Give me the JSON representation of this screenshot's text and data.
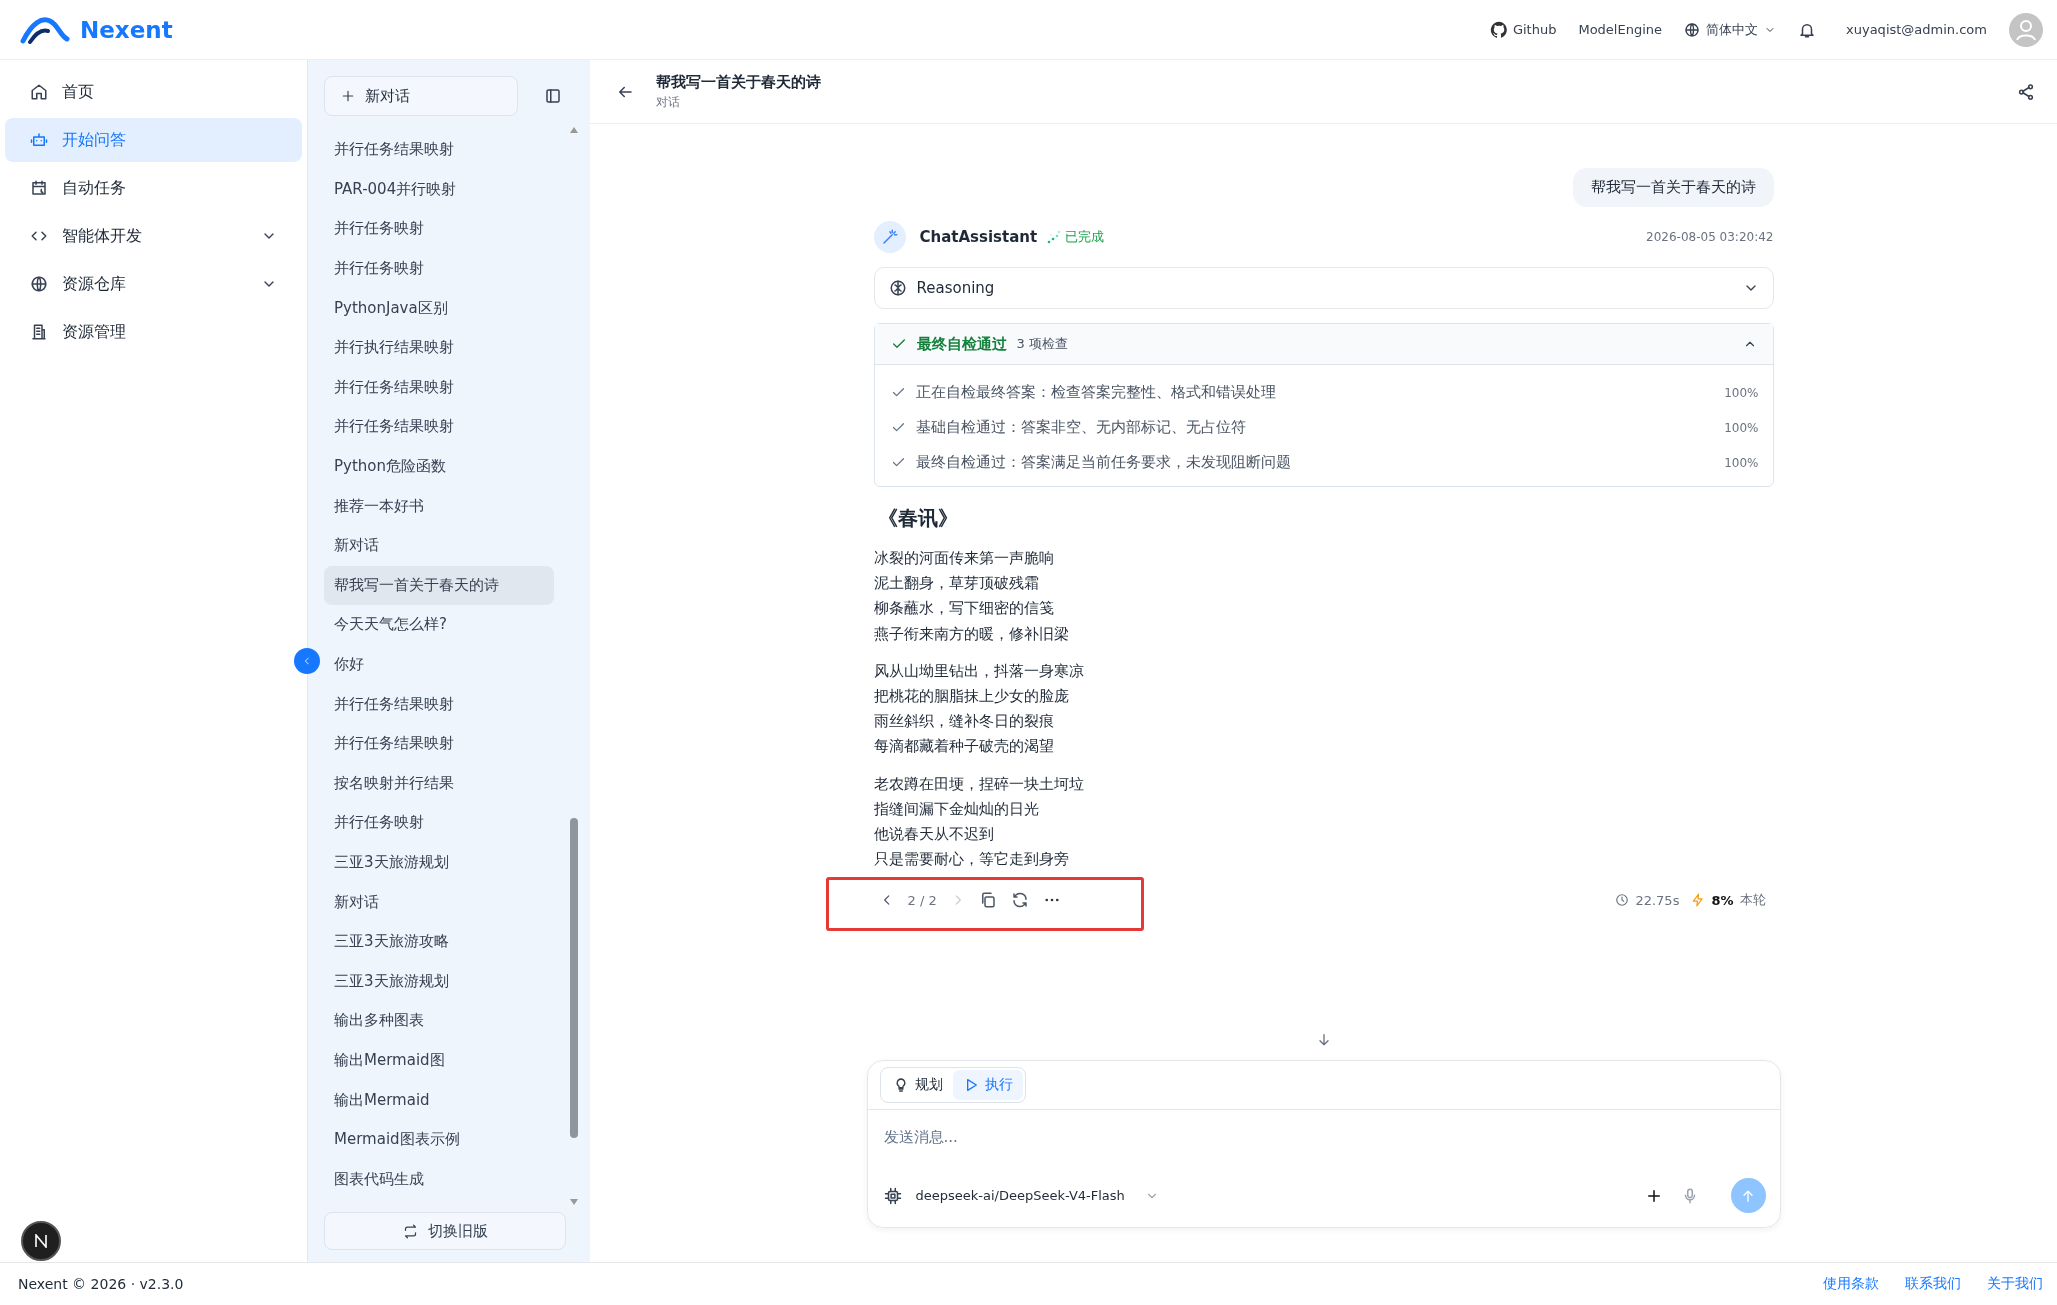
{
  "header": {
    "logo": "Nexent",
    "links": [
      "Github",
      "ModelEngine"
    ],
    "language": "简体中文",
    "user_email": "xuyaqist@admin.com"
  },
  "nav": {
    "items": [
      {
        "label": "首页",
        "selected": false,
        "submenu": false
      },
      {
        "label": "开始问答",
        "selected": true,
        "submenu": false
      },
      {
        "label": "自动任务",
        "selected": false,
        "submenu": false
      },
      {
        "label": "智能体开发",
        "selected": false,
        "submenu": true
      },
      {
        "label": "资源仓库",
        "selected": false,
        "submenu": true
      },
      {
        "label": "资源管理",
        "selected": false,
        "submenu": false
      }
    ]
  },
  "conversations": {
    "new_button": "新对话",
    "switch_button": "切换旧版",
    "items": [
      {
        "title": "并行任务结果映射",
        "selected": false
      },
      {
        "title": "PAR-004并行映射",
        "selected": false
      },
      {
        "title": "并行任务映射",
        "selected": false
      },
      {
        "title": "并行任务映射",
        "selected": false
      },
      {
        "title": "PythonJava区别",
        "selected": false
      },
      {
        "title": "并行执行结果映射",
        "selected": false
      },
      {
        "title": "并行任务结果映射",
        "selected": false
      },
      {
        "title": "并行任务结果映射",
        "selected": false
      },
      {
        "title": "Python危险函数",
        "selected": false
      },
      {
        "title": "推荐一本好书",
        "selected": false
      },
      {
        "title": "新对话",
        "selected": false
      },
      {
        "title": "帮我写一首关于春天的诗",
        "selected": true
      },
      {
        "title": "今天天气怎么样?",
        "selected": false
      },
      {
        "title": "你好",
        "selected": false
      },
      {
        "title": "并行任务结果映射",
        "selected": false
      },
      {
        "title": "并行任务结果映射",
        "selected": false
      },
      {
        "title": "按名映射并行结果",
        "selected": false
      },
      {
        "title": "并行任务映射",
        "selected": false
      },
      {
        "title": "三亚3天旅游规划",
        "selected": false
      },
      {
        "title": "新对话",
        "selected": false
      },
      {
        "title": "三亚3天旅游攻略",
        "selected": false
      },
      {
        "title": "三亚3天旅游规划",
        "selected": false
      },
      {
        "title": "输出多种图表",
        "selected": false
      },
      {
        "title": "输出Mermaid图",
        "selected": false
      },
      {
        "title": "输出Mermaid",
        "selected": false
      },
      {
        "title": "Mermaid图表示例",
        "selected": false
      },
      {
        "title": "图表代码生成",
        "selected": false
      }
    ]
  },
  "chat": {
    "title": "帮我写一首关于春天的诗",
    "subtitle": "对话",
    "user_message": "帮我写一首关于春天的诗",
    "assistant": {
      "name": "ChatAssistant",
      "status": "已完成",
      "time": "2026-08-05 03:20:42"
    },
    "reasoning": {
      "label": "Reasoning",
      "expanded": false
    },
    "check": {
      "title": "最终自检通过",
      "count": "3 项检查",
      "expanded": true,
      "items": [
        {
          "text": "正在自检最终答案：检查答案完整性、格式和错误处理",
          "percent": "100%"
        },
        {
          "text": "基础自检通过：答案非空、无内部标记、无占位符",
          "percent": "100%"
        },
        {
          "text": "最终自检通过：答案满足当前任务要求，未发现阻断问题",
          "percent": "100%"
        }
      ]
    },
    "poem": {
      "title": "《春讯》",
      "stanzas": [
        [
          "冰裂的河面传来第一声脆响",
          "泥土翻身，草芽顶破残霜",
          "柳条蘸水，写下细密的信笺",
          "燕子衔来南方的暖，修补旧梁"
        ],
        [
          "风从山坳里钻出，抖落一身寒凉",
          "把桃花的胭脂抹上少女的脸庞",
          "雨丝斜织，缝补冬日的裂痕",
          "每滴都藏着种子破壳的渴望"
        ],
        [
          "老农蹲在田埂，捏碎一块土坷垃",
          "指缝间漏下金灿灿的日光",
          "他说春天从不迟到",
          "只是需要耐心，等它走到身旁"
        ]
      ]
    },
    "actions": {
      "pager": "2 / 2",
      "highlighted": true,
      "duration": "22.75s",
      "usage": "8%",
      "usage_label": "本轮"
    }
  },
  "composer": {
    "modes": [
      {
        "label": "规划",
        "selected": false
      },
      {
        "label": "执行",
        "selected": true
      }
    ],
    "placeholder": "发送消息...",
    "model": "deepseek-ai/DeepSeek-V4-Flash",
    "send_disabled": true
  },
  "footer": {
    "copyright": "Nexent © 2026 · v2.3.0",
    "links": [
      "使用条款",
      "联系我们",
      "关于我们"
    ]
  }
}
